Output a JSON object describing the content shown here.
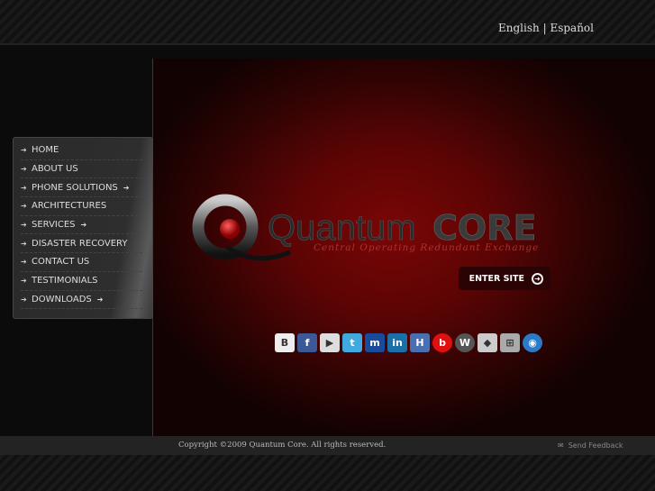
{
  "header": {
    "lang_english": "English",
    "lang_sep": "|",
    "lang_espanol": "Español"
  },
  "menu": [
    {
      "label": "HOME",
      "sub": false
    },
    {
      "label": "ABOUT US",
      "sub": false
    },
    {
      "label": "PHONE SOLUTIONS",
      "sub": true
    },
    {
      "label": "ARCHITECTURES",
      "sub": false
    },
    {
      "label": "SERVICES",
      "sub": true
    },
    {
      "label": "DISASTER RECOVERY",
      "sub": false
    },
    {
      "label": "CONTACT US",
      "sub": false
    },
    {
      "label": "TESTIMONIALS",
      "sub": false
    },
    {
      "label": "DOWNLOADS",
      "sub": true
    }
  ],
  "logo": {
    "word1": "Quantum",
    "word2": "CORE",
    "tagline": "Central Operating Redundant Exchange"
  },
  "enter_label": "ENTER SITE",
  "social": [
    {
      "name": "blog",
      "glyph": "B",
      "color": "#eeeeee"
    },
    {
      "name": "facebook",
      "glyph": "f",
      "color": "#3b5998"
    },
    {
      "name": "youtube",
      "glyph": "▶",
      "color": "#dddddd"
    },
    {
      "name": "twitter",
      "glyph": "t",
      "color": "#3fa9e0"
    },
    {
      "name": "myspace",
      "glyph": "m",
      "color": "#1a4b9b"
    },
    {
      "name": "linkedin",
      "glyph": "in",
      "color": "#1a70a8"
    },
    {
      "name": "hi5",
      "glyph": "H",
      "color": "#4a6fb0"
    },
    {
      "name": "bebo",
      "glyph": "b",
      "color": "#e01010"
    },
    {
      "name": "wordpress",
      "glyph": "W",
      "color": "#555555"
    },
    {
      "name": "delicious",
      "glyph": "◆",
      "color": "#cccccc"
    },
    {
      "name": "network",
      "glyph": "⊞",
      "color": "#aaaaaa"
    },
    {
      "name": "globe",
      "glyph": "◉",
      "color": "#2a7ac8"
    }
  ],
  "footer": {
    "copyright": "Copyright ©2009 Quantum Core. All rights reserved.",
    "feedback": "Send Feedback"
  }
}
